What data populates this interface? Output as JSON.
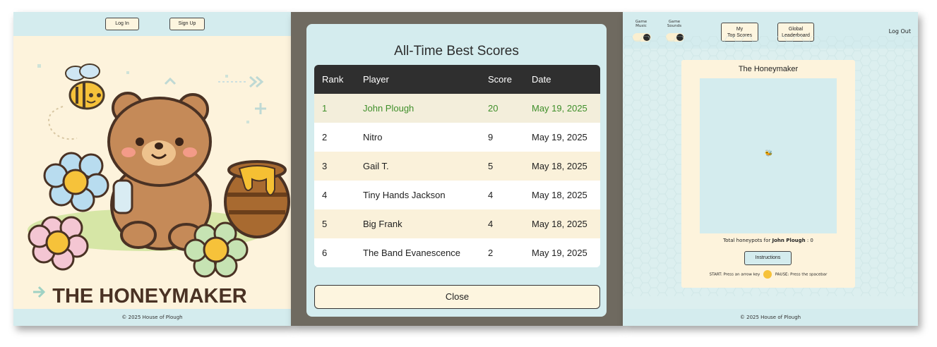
{
  "left_panel": {
    "login_label": "Log In",
    "signup_label": "Sign Up",
    "game_logo_text": "THE HONEYMAKER",
    "footer": "© 2025 House of Plough"
  },
  "modal": {
    "title": "All-Time Best Scores",
    "columns": [
      "Rank",
      "Player",
      "Score",
      "Date"
    ],
    "rows": [
      {
        "rank": "1",
        "player": "John Plough",
        "score": "20",
        "date": "May 19, 2025"
      },
      {
        "rank": "2",
        "player": "Nitro",
        "score": "9",
        "date": "May 19, 2025"
      },
      {
        "rank": "3",
        "player": "Gail T.",
        "score": "5",
        "date": "May 18, 2025"
      },
      {
        "rank": "4",
        "player": "Tiny Hands Jackson",
        "score": "4",
        "date": "May 18, 2025"
      },
      {
        "rank": "5",
        "player": "Big Frank",
        "score": "4",
        "date": "May 18, 2025"
      },
      {
        "rank": "6",
        "player": "The Band Evanescence",
        "score": "2",
        "date": "May 19, 2025"
      }
    ],
    "close_label": "Close"
  },
  "right_panel": {
    "music_label": "Game\nMusic",
    "sounds_label": "Game\nSounds",
    "my_scores_label": "My\nTop Scores",
    "global_label": "Global\nLeaderboard",
    "logout_label": "Log Out",
    "game_title": "The Honeymaker",
    "total_prefix": "Total honeypots for ",
    "player_name": "John Plough",
    "total_suffix": " : 0",
    "instructions_label": "Instructions",
    "start_hint": "START: Press an arrow key",
    "pause_hint": "PAUSE: Press the spacebar",
    "footer": "© 2025 House of Plough"
  },
  "colors": {
    "accent_green": "#3f8f2a",
    "header_dark": "#2f2f2f",
    "cream": "#fdf3dc",
    "teal_light": "#d4ecee"
  }
}
